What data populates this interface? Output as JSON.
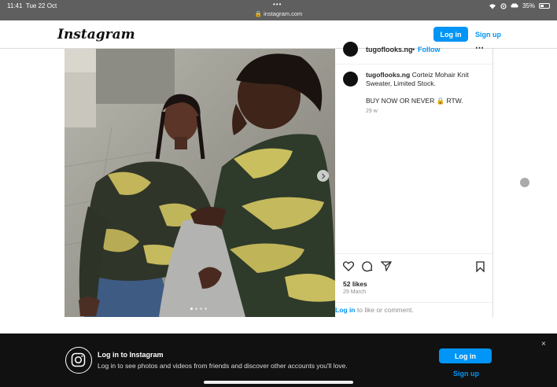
{
  "status_bar": {
    "time": "11:41",
    "date": "Tue 22 Oct",
    "url": "instagram.com",
    "battery": "35%",
    "battery_level": 0.35
  },
  "header": {
    "logo": "Instagram",
    "login_label": "Log in",
    "signup_label": "Sign up"
  },
  "post": {
    "username": "tugoflooks.ng",
    "follow_label": "Follow",
    "separator": "•",
    "more_icon": "more-icon",
    "caption_username": "tugoflooks.ng",
    "caption_text": "Corteiz Mohair Knit Sweater, Limited Stock.",
    "caption_line2": "BUY NOW OR NEVER 🔒 RTW.",
    "caption_age": "29 w",
    "likes": "52 likes",
    "date": "29 March",
    "login_prompt_link": "Log in",
    "login_prompt_rest": "to like or comment.",
    "carousel_count": 4,
    "carousel_active": 0
  },
  "banner": {
    "title": "Log in to Instagram",
    "text": "Log in to see photos and videos from friends and discover other accounts you'll love.",
    "login_label": "Log in",
    "signup_label": "Sign up",
    "close": "×"
  },
  "colors": {
    "accent": "#0095f6",
    "banner_bg": "#111111"
  }
}
